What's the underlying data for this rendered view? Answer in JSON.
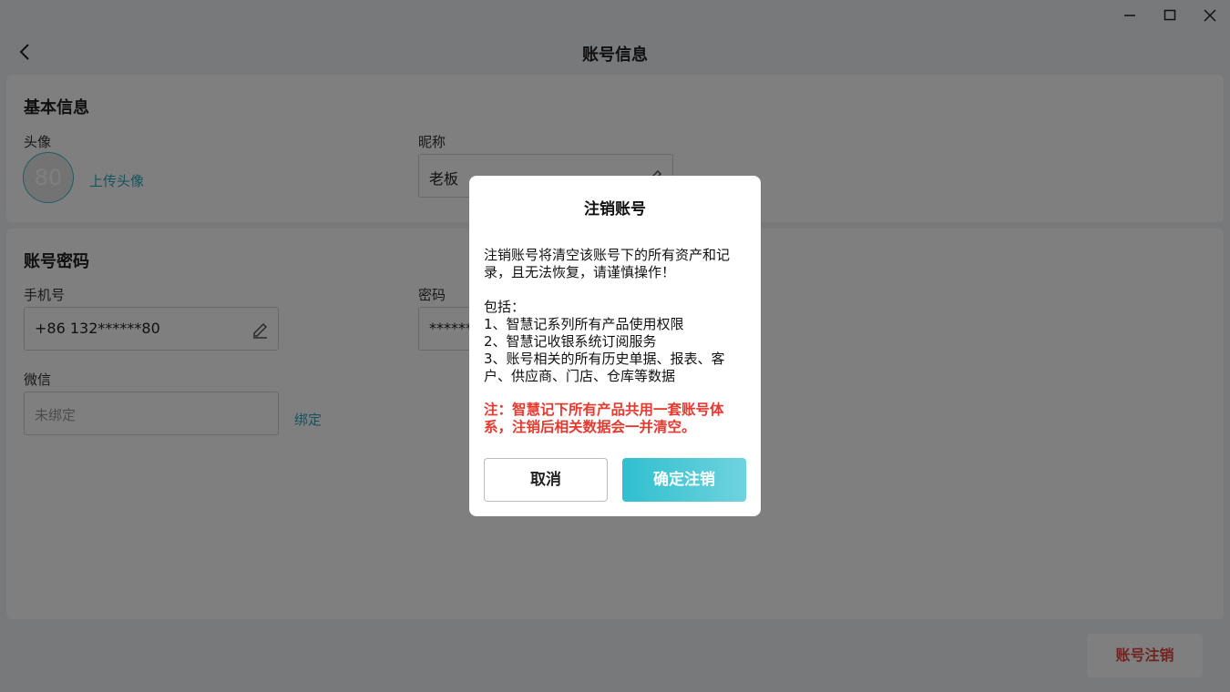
{
  "window": {
    "minimize_icon": "minimize-icon",
    "maximize_icon": "maximize-icon",
    "close_icon": "close-icon"
  },
  "header": {
    "title": "账号信息",
    "back_icon": "chevron-left-icon"
  },
  "basic_info": {
    "title": "基本信息",
    "avatar_label": "头像",
    "avatar_text": "80",
    "upload_link": "上传头像",
    "nickname_label": "昵称",
    "nickname_value": "老板"
  },
  "account_password": {
    "title": "账号密码",
    "phone_label": "手机号",
    "phone_value": "+86 132******80",
    "password_label": "密码",
    "password_value": "******",
    "wechat_label": "微信",
    "wechat_placeholder": "未绑定",
    "bind_link": "绑定"
  },
  "footer": {
    "deactivate_button": "账号注销"
  },
  "dialog": {
    "title": "注销账号",
    "intro": "注销账号将清空该账号下的所有资产和记录，且无法恢复，请谨慎操作！",
    "includes_label": "包括：",
    "items": [
      "1、智慧记系列所有产品使用权限",
      "2、智慧记收银系统订阅服务",
      "3、账号相关的所有历史单据、报表、客户、供应商、门店、仓库等数据"
    ],
    "warning": "注：智慧记下所有产品共用一套账号体系，注销后相关数据会一并清空。",
    "cancel_button": "取消",
    "confirm_button": "确定注销"
  },
  "colors": {
    "accent": "#2aa9bd",
    "danger": "#e6392f"
  }
}
